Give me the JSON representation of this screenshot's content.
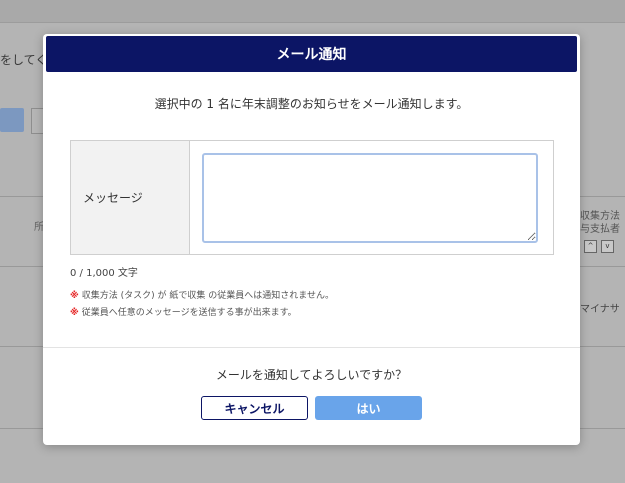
{
  "background": {
    "instruction_fragment": "をしてく",
    "column_stub": "所",
    "right_column_header_1": "収集方法",
    "right_column_header_2": "与支払者",
    "sort_up": "^",
    "sort_down": "v",
    "right_column_value": "マイナサ"
  },
  "modal": {
    "title": "メール通知",
    "subtitle": "選択中の 1 名に年末調整のお知らせをメール通知します。",
    "form": {
      "message_label": "メッセージ",
      "message_value": ""
    },
    "char_count": "0 / 1,000 文字",
    "notes": [
      {
        "mark": "※",
        "text": "収集方法 (タスク) が 紙で収集 の従業員へは通知されません。"
      },
      {
        "mark": "※",
        "text": "従業員へ任意のメッセージを送信する事が出来ます。"
      }
    ],
    "confirm_text": "メールを通知してよろしいですか？",
    "cancel_label": "キャンセル",
    "yes_label": "はい"
  }
}
